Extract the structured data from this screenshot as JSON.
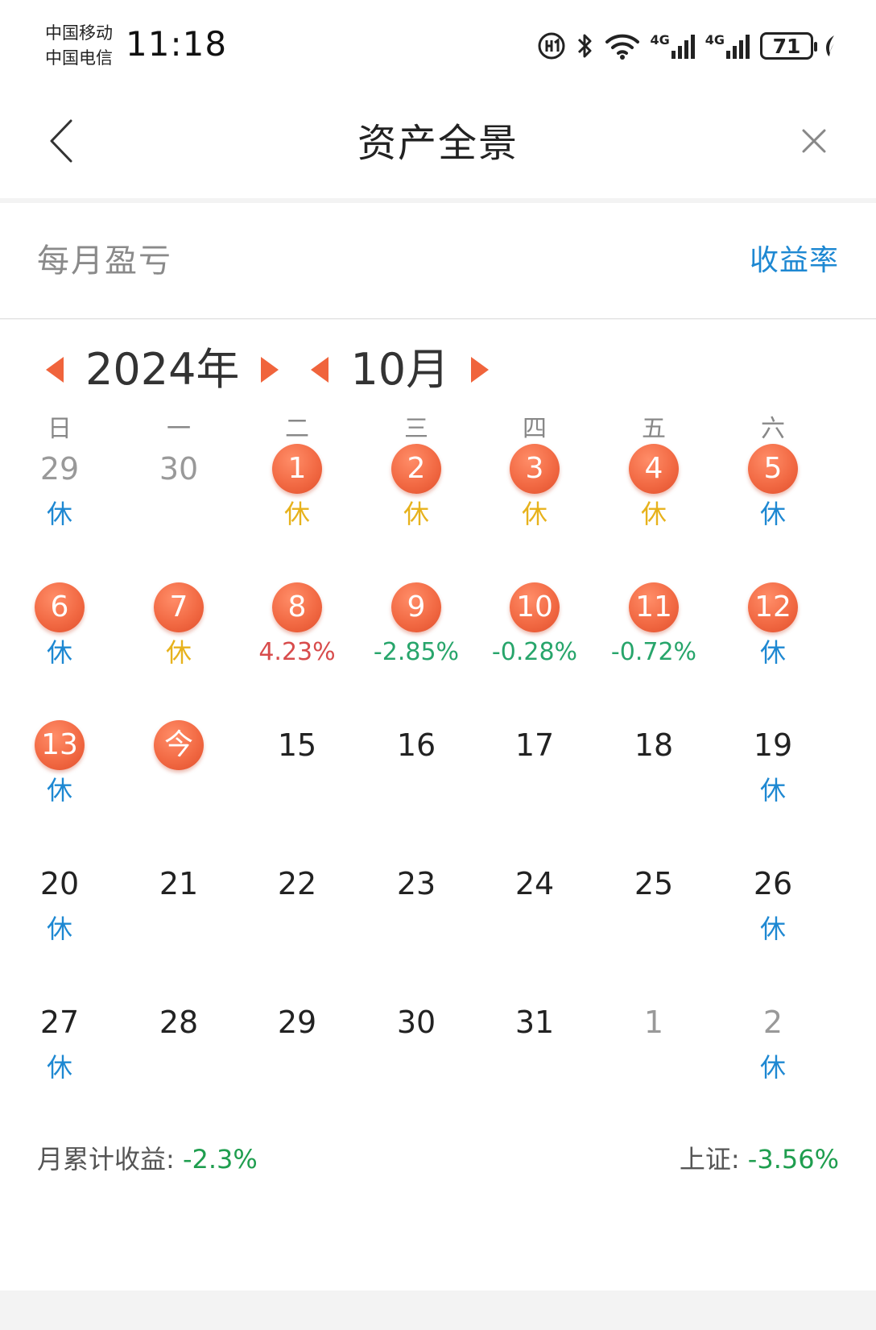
{
  "status_bar": {
    "carrier_1": "中国移动",
    "carrier_2": "中国电信",
    "time": "11:18",
    "signal_1_label": "4G",
    "signal_2_label": "4G",
    "battery": "71"
  },
  "nav": {
    "title": "资产全景"
  },
  "section": {
    "title": "每月盈亏",
    "rate_link": "收益率"
  },
  "calendar": {
    "year_label": "2024年",
    "month_label": "10月",
    "weekdays": [
      "日",
      "一",
      "二",
      "三",
      "四",
      "五",
      "六"
    ],
    "rows": [
      [
        {
          "day": "29",
          "style": "muted",
          "sub": "休",
          "sub_color": "blue"
        },
        {
          "day": "30",
          "style": "muted",
          "sub": "",
          "sub_color": ""
        },
        {
          "day": "1",
          "style": "bubble",
          "sub": "休",
          "sub_color": "yellow"
        },
        {
          "day": "2",
          "style": "bubble",
          "sub": "休",
          "sub_color": "yellow"
        },
        {
          "day": "3",
          "style": "bubble",
          "sub": "休",
          "sub_color": "yellow"
        },
        {
          "day": "4",
          "style": "bubble",
          "sub": "休",
          "sub_color": "yellow"
        },
        {
          "day": "5",
          "style": "bubble",
          "sub": "休",
          "sub_color": "blue"
        }
      ],
      [
        {
          "day": "6",
          "style": "bubble",
          "sub": "休",
          "sub_color": "blue"
        },
        {
          "day": "7",
          "style": "bubble",
          "sub": "休",
          "sub_color": "yellow"
        },
        {
          "day": "8",
          "style": "bubble",
          "sub": "4.23%",
          "sub_color": "red"
        },
        {
          "day": "9",
          "style": "bubble",
          "sub": "-2.85%",
          "sub_color": "green"
        },
        {
          "day": "10",
          "style": "bubble",
          "sub": "-0.28%",
          "sub_color": "green"
        },
        {
          "day": "11",
          "style": "bubble",
          "sub": "-0.72%",
          "sub_color": "green"
        },
        {
          "day": "12",
          "style": "bubble",
          "sub": "休",
          "sub_color": "blue"
        }
      ],
      [
        {
          "day": "13",
          "style": "bubble",
          "sub": "休",
          "sub_color": "blue"
        },
        {
          "day": "今",
          "style": "bubble",
          "sub": "",
          "sub_color": ""
        },
        {
          "day": "15",
          "style": "normal",
          "sub": "",
          "sub_color": ""
        },
        {
          "day": "16",
          "style": "normal",
          "sub": "",
          "sub_color": ""
        },
        {
          "day": "17",
          "style": "normal",
          "sub": "",
          "sub_color": ""
        },
        {
          "day": "18",
          "style": "normal",
          "sub": "",
          "sub_color": ""
        },
        {
          "day": "19",
          "style": "normal",
          "sub": "休",
          "sub_color": "blue"
        }
      ],
      [
        {
          "day": "20",
          "style": "normal",
          "sub": "休",
          "sub_color": "blue"
        },
        {
          "day": "21",
          "style": "normal",
          "sub": "",
          "sub_color": ""
        },
        {
          "day": "22",
          "style": "normal",
          "sub": "",
          "sub_color": ""
        },
        {
          "day": "23",
          "style": "normal",
          "sub": "",
          "sub_color": ""
        },
        {
          "day": "24",
          "style": "normal",
          "sub": "",
          "sub_color": ""
        },
        {
          "day": "25",
          "style": "normal",
          "sub": "",
          "sub_color": ""
        },
        {
          "day": "26",
          "style": "normal",
          "sub": "休",
          "sub_color": "blue"
        }
      ],
      [
        {
          "day": "27",
          "style": "normal",
          "sub": "休",
          "sub_color": "blue"
        },
        {
          "day": "28",
          "style": "normal",
          "sub": "",
          "sub_color": ""
        },
        {
          "day": "29",
          "style": "normal",
          "sub": "",
          "sub_color": ""
        },
        {
          "day": "30",
          "style": "normal",
          "sub": "",
          "sub_color": ""
        },
        {
          "day": "31",
          "style": "normal",
          "sub": "",
          "sub_color": ""
        },
        {
          "day": "1",
          "style": "muted",
          "sub": "",
          "sub_color": ""
        },
        {
          "day": "2",
          "style": "muted",
          "sub": "休",
          "sub_color": "blue"
        }
      ]
    ]
  },
  "summary": {
    "monthly_label": "月累计收益:",
    "monthly_value": "-2.3%",
    "index_label": "上证:",
    "index_value": "-3.56%"
  },
  "colors": {
    "accent": "#f0643c",
    "link_blue": "#1e88d2",
    "holiday_yellow": "#e7b21c",
    "gain_red": "#d84c4c",
    "loss_green": "#27a56b"
  }
}
